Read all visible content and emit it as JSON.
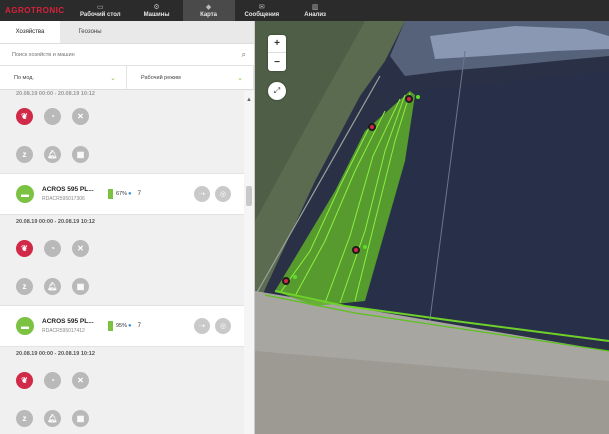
{
  "brand": "AGROTRONIC",
  "nav": [
    {
      "label": "Рабочий стол",
      "icon": "desktop-icon"
    },
    {
      "label": "Машины",
      "icon": "machines-icon"
    },
    {
      "label": "Карта",
      "icon": "map-icon",
      "active": true
    },
    {
      "label": "Сообщения",
      "icon": "messages-icon"
    },
    {
      "label": "Анализ",
      "icon": "analysis-icon"
    }
  ],
  "tabs": [
    "Хозяйства",
    "Геозоны"
  ],
  "search": {
    "placeholder": "Поиск хозяйств и машин"
  },
  "filters": {
    "sort": "По мод.",
    "mode": "Рабочий режим"
  },
  "list": {
    "top_partial_date": "20.08.19 00:00 - 20.08.19 10:12",
    "machines": [
      {
        "name": "ACROS 595 PL...",
        "serial": "RDACR595017306",
        "fuel_pct": "67%",
        "count": "7",
        "date": "20.08.19 00:00 - 20.08.19 10:12"
      },
      {
        "name": "ACROS 595 PL...",
        "serial": "RDACR595017412",
        "fuel_pct": "95%",
        "count": "7",
        "date": "20.08.19 00:00 - 20.08.19 10:12"
      }
    ]
  },
  "map_controls": {
    "zoom_in": "+",
    "zoom_out": "−"
  },
  "colors": {
    "accent_red": "#d12a48",
    "accent_green": "#7cc242",
    "nav_bg": "#2b2b2b",
    "track_green": "#6fd02a"
  }
}
